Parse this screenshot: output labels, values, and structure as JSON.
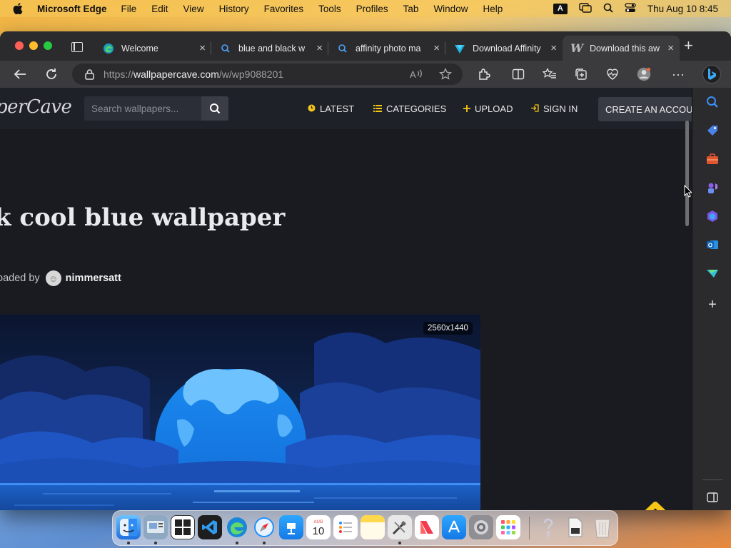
{
  "menubar": {
    "app_name": "Microsoft Edge",
    "items": [
      "File",
      "Edit",
      "View",
      "History",
      "Favorites",
      "Tools",
      "Profiles",
      "Tab",
      "Window",
      "Help"
    ],
    "input_source": "A",
    "clock": "Thu Aug 10  8:45"
  },
  "tabs": [
    {
      "label": "Welcome",
      "icon": "edge-icon",
      "active": false
    },
    {
      "label": "blue and black w",
      "icon": "search-icon",
      "active": false
    },
    {
      "label": "affinity photo ma",
      "icon": "search-icon",
      "active": false
    },
    {
      "label": "Download Affinity",
      "icon": "affinity-icon",
      "active": false
    },
    {
      "label": "Download this aw",
      "icon": "wallpapercave-icon",
      "active": true
    }
  ],
  "address": {
    "scheme": "https://",
    "host": "wallpapercave.com",
    "path": "/w/wp9088201"
  },
  "site": {
    "logo": "perCave",
    "search_placeholder": "Search wallpapers...",
    "nav": [
      {
        "label": "LATEST",
        "icon": "clock-icon"
      },
      {
        "label": "CATEGORIES",
        "icon": "list-icon"
      },
      {
        "label": "UPLOAD",
        "icon": "plus-icon"
      },
      {
        "label": "SIGN IN",
        "icon": "signin-icon"
      }
    ],
    "create_account": "CREATE AN ACCOUN"
  },
  "content": {
    "title": "k cool blue wallpaper",
    "uploaded_by_prefix": "oaded by",
    "uploader": "nimmersatt",
    "resolution": "2560x1440"
  },
  "colors": {
    "accent_yellow": "#f5c518",
    "page_bg": "#191b21",
    "wallpaper_blue": "#1e7ee6"
  }
}
